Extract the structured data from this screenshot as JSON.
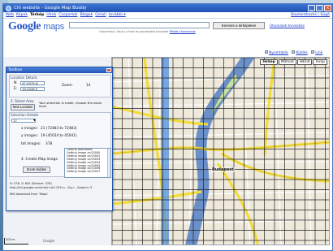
{
  "window": {
    "title": "Citi website - Google Map Buddy",
    "buttons": [
      "_",
      "□",
      "×"
    ]
  },
  "gbar": {
    "links": [
      "Web",
      "Képek",
      "Térkép",
      "Hírek",
      "Csoportok",
      "Blogok",
      "Gmail",
      "további ▾"
    ],
    "active_index": 2,
    "right_link": "Bejelentkezés | Súgó"
  },
  "header": {
    "logo_google": "Google",
    "logo_maps": "maps",
    "search_value": "",
    "search_hint": "Udvarhelyi, lásd a címet és pontosabb helyeket",
    "search_hint_link": "Például keresések",
    "search_button": "Keresés a térképeken",
    "directions_link": "Útvonalak tervezése"
  },
  "map_links": {
    "print": "Nyomtatás",
    "send": "Küldés",
    "link": "Link"
  },
  "map": {
    "tabs": [
      "Térkép",
      "Műhold",
      "Hibrid",
      "Terep"
    ],
    "active_tab": 0,
    "city_label": "Budapest",
    "scale_label": "200 m",
    "mini_logo": "Google"
  },
  "colors": {
    "river": "#6b8fc8",
    "major_road": "#f2dc3b",
    "grid_line": "#222222",
    "selection": "#4f8fe0"
  },
  "toolbox": {
    "title": "Toolbox",
    "location_details_label": "Location Details",
    "n_label": "N:",
    "n_value": "47.5079 N",
    "e_label": "E:",
    "e_value": "19.0446 E",
    "zoom_label": "Zoom:",
    "zoom_value": "14",
    "select_area_label": "2. Select Area",
    "new_location_button": "New Location",
    "selection_note": "Your selection is made, choose the zoom level",
    "selection_details_label": "Selection Details",
    "zoom_select_value": "17",
    "x_images_label": "x images:",
    "x_images_value": "21 (72483 to 72483)",
    "y_images_label": "y images:",
    "y_images_value": "19 (45024 to 45041)",
    "total_images_label": "tot images:",
    "total_images_value": "378",
    "create_label": "4. Create Map Image",
    "zoom_hidden_button": "Zoom Hidden",
    "log_lines": [
      "Getting downloads",
      "Getting image xx/10000",
      "Getting image xx/10002",
      "Getting image xx/10003",
      "Getting image xx/10004",
      "Getting image xx/10005",
      "Getting image xx/10006",
      "Getting image xx/10007"
    ],
    "footer_line1": "H: 576, V: 605 (Stream: 378)",
    "footer_line2": "http://mt.google.com/mt/v=w2.10?x=...&y=...&zoom=3",
    "footer_line3": "Will download from 'Maps'"
  }
}
